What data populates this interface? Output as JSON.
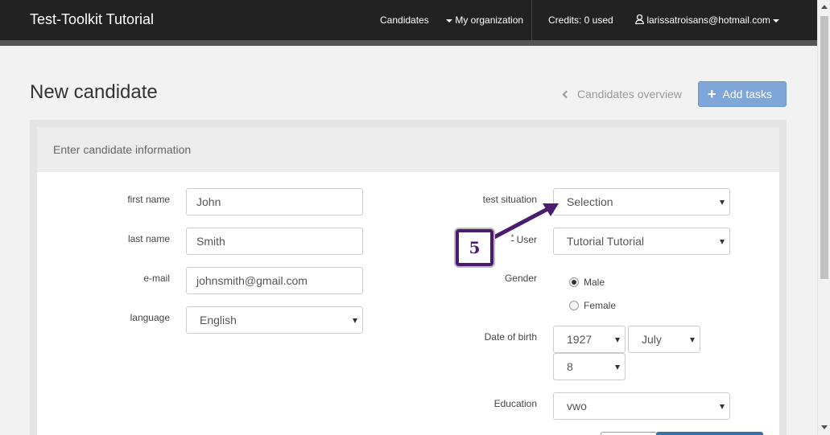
{
  "navbar": {
    "brand": "Test-Toolkit Tutorial",
    "candidates": "Candidates",
    "my_organization": "My organization",
    "credits": "Credits: 0 used",
    "user_email": "larissatroisans@hotmail.com"
  },
  "page": {
    "title": "New candidate",
    "overview_link": "Candidates overview",
    "add_tasks": "Add tasks"
  },
  "panel": {
    "heading": "Enter candidate information"
  },
  "form": {
    "first_name_label": "first name",
    "first_name_value": "John",
    "last_name_label": "last name",
    "last_name_value": "Smith",
    "email_label": "e-mail",
    "email_value": "johnsmith@gmail.com",
    "language_label": "language",
    "language_value": "English",
    "test_situation_label": "test situation",
    "test_situation_value": "Selection",
    "user_required_mark": "*",
    "user_label": "User",
    "user_value": "Tutorial Tutorial",
    "gender_label": "Gender",
    "gender_options": [
      "Male",
      "Female"
    ],
    "gender_selected": "Male",
    "dob_label": "Date of birth",
    "dob_year": "1927",
    "dob_month": "July",
    "dob_day": "8",
    "education_label": "Education",
    "education_value": "vwo"
  },
  "callout": {
    "step": "5",
    "color": "#4b1b6f"
  },
  "colors": {
    "navbar_bg": "#222222",
    "primary_button": "#7ea6d6"
  }
}
